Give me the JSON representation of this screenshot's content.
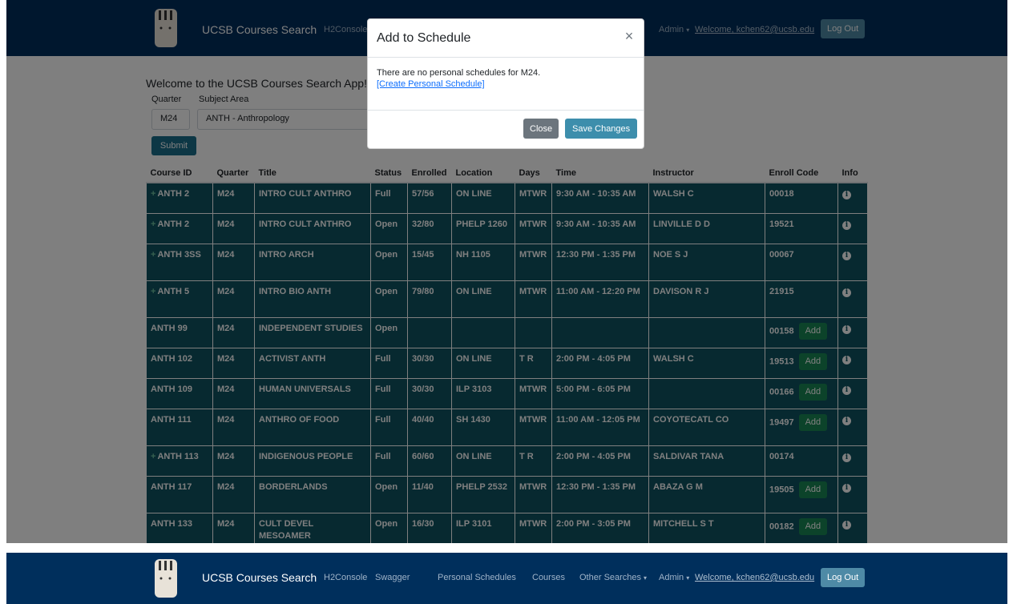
{
  "navbar": {
    "brand": "UCSB Courses Search",
    "links": [
      "H2Console",
      "Swagger",
      "Personal Schedules",
      "Courses",
      "Other Searches"
    ],
    "admin": "Admin",
    "welcome": "Welcome, kchen62@ucsb.edu",
    "logout": "Log Out"
  },
  "page": {
    "welcome": "Welcome to the UCSB Courses Search App!",
    "quarter_label": "Quarter",
    "subject_label": "Subject Area",
    "quarter_value": "M24",
    "subject_value": "ANTH - Anthropology",
    "submit": "Submit"
  },
  "table": {
    "headers": [
      "Course ID",
      "Quarter",
      "Title",
      "Status",
      "Enrolled",
      "Location",
      "Days",
      "Time",
      "Instructor",
      "Enroll Code",
      "Info"
    ],
    "add_label": "Add",
    "rows": [
      {
        "id": "ANTH 2",
        "plus": true,
        "quarter": "M24",
        "title": "INTRO CULT ANTHRO",
        "status": "Full",
        "enrolled": "57/56",
        "location": "ON LINE",
        "days": "MTWR",
        "time": "9:30 AM - 10:35 AM",
        "instructor": "WALSH C",
        "code": "00018",
        "add": false
      },
      {
        "id": "ANTH 2",
        "plus": true,
        "quarter": "M24",
        "title": "INTRO CULT ANTHRO",
        "status": "Open",
        "enrolled": "32/80",
        "location": "PHELP 1260",
        "days": "MTWR",
        "time": "9:30 AM - 10:35 AM",
        "instructor": "LINVILLE D D",
        "code": "19521",
        "add": false
      },
      {
        "id": "ANTH 3SS",
        "plus": true,
        "quarter": "M24",
        "title": "INTRO ARCH",
        "status": "Open",
        "enrolled": "15/45",
        "location": "NH 1105",
        "days": "MTWR",
        "time": "12:30 PM - 1:35 PM",
        "instructor": "NOE S J",
        "code": "00067",
        "add": false
      },
      {
        "id": "ANTH 5",
        "plus": true,
        "quarter": "M24",
        "title": "INTRO BIO ANTH",
        "status": "Open",
        "enrolled": "79/80",
        "location": "ON LINE",
        "days": "MTWR",
        "time": "11:00 AM - 12:20 PM",
        "instructor": "DAVISON R J",
        "code": "21915",
        "add": false
      },
      {
        "id": "ANTH 99",
        "plus": false,
        "quarter": "M24",
        "title": "INDEPENDENT STUDIES",
        "status": "Open",
        "enrolled": "",
        "location": "",
        "days": "",
        "time": "",
        "instructor": "",
        "code": "00158",
        "add": true
      },
      {
        "id": "ANTH 102",
        "plus": false,
        "quarter": "M24",
        "title": "ACTIVIST ANTH",
        "status": "Full",
        "enrolled": "30/30",
        "location": "ON LINE",
        "days": "T R",
        "time": "2:00 PM - 4:05 PM",
        "instructor": "WALSH C",
        "code": "19513",
        "add": true
      },
      {
        "id": "ANTH 109",
        "plus": false,
        "quarter": "M24",
        "title": "HUMAN UNIVERSALS",
        "status": "Full",
        "enrolled": "30/30",
        "location": "ILP 3103",
        "days": "MTWR",
        "time": "5:00 PM - 6:05 PM",
        "instructor": "",
        "code": "00166",
        "add": true
      },
      {
        "id": "ANTH 111",
        "plus": false,
        "quarter": "M24",
        "title": "ANTHRO OF FOOD",
        "status": "Full",
        "enrolled": "40/40",
        "location": "SH 1430",
        "days": "MTWR",
        "time": "11:00 AM - 12:05 PM",
        "instructor": "COYOTECATL CO",
        "code": "19497",
        "add": true
      },
      {
        "id": "ANTH 113",
        "plus": true,
        "quarter": "M24",
        "title": "INDIGENOUS PEOPLE",
        "status": "Full",
        "enrolled": "60/60",
        "location": "ON LINE",
        "days": "T R",
        "time": "2:00 PM - 4:05 PM",
        "instructor": "SALDIVAR TANA",
        "code": "00174",
        "add": false
      },
      {
        "id": "ANTH 117",
        "plus": false,
        "quarter": "M24",
        "title": "BORDERLANDS",
        "status": "Open",
        "enrolled": "11/40",
        "location": "PHELP 2532",
        "days": "MTWR",
        "time": "12:30 PM - 1:35 PM",
        "instructor": "ABAZA G M",
        "code": "19505",
        "add": true
      },
      {
        "id": "ANTH 133",
        "plus": false,
        "quarter": "M24",
        "title": "CULT DEVEL MESOAMER",
        "status": "Open",
        "enrolled": "16/30",
        "location": "ILP 3101",
        "days": "MTWR",
        "time": "2:00 PM - 3:05 PM",
        "instructor": "MITCHELL S T",
        "code": "00182",
        "add": true
      }
    ]
  },
  "modal": {
    "title": "Add to Schedule",
    "close_glyph": "×",
    "message": "There are no personal schedules for M24.",
    "link": "[Create Personal Schedule]",
    "close_button": "Close",
    "save_button": "Save Changes"
  }
}
